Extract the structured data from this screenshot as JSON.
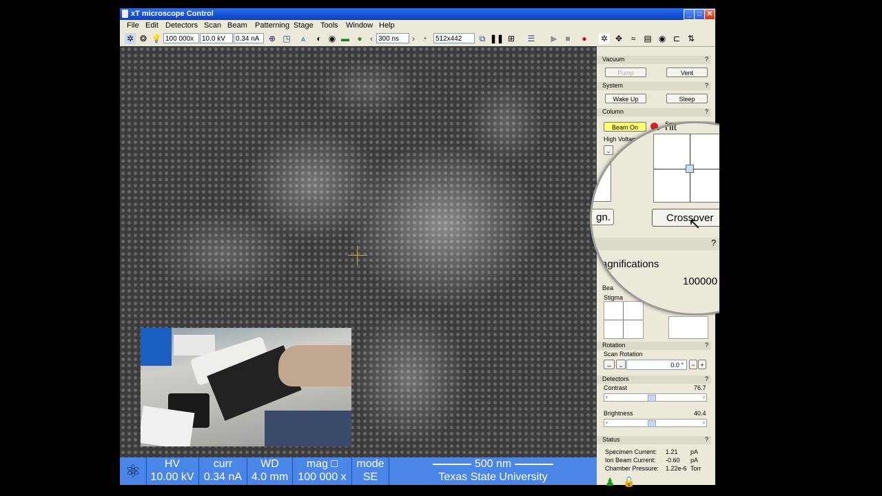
{
  "window": {
    "title": "xT microscope Control"
  },
  "menu": [
    "File",
    "Edit",
    "Detectors",
    "Scan",
    "Beam",
    "Patterning",
    "Stage",
    "Tools",
    "Window",
    "Help"
  ],
  "toolbar": {
    "magnification": "100 000x",
    "voltage": "10.0 kV",
    "current": "0.34 nA",
    "dwell": "300 ns",
    "resolution": "512x442"
  },
  "databar": {
    "hv_label": "HV",
    "hv_value": "10.00 kV",
    "curr_label": "curr",
    "curr_value": "0.34 nA",
    "wd_label": "WD",
    "wd_value": "4.0 mm",
    "mag_label": "mag",
    "mag_value": "100 000 x",
    "mode_label": "mode",
    "mode_value": "SE",
    "scalebar": "500 nm",
    "institution": "Texas State University"
  },
  "panel": {
    "vacuum": {
      "title": "Vacuum",
      "pump": "Pump",
      "vent": "Vent"
    },
    "system": {
      "title": "System",
      "wake": "Wake Up",
      "sleep": "Sleep"
    },
    "column": {
      "title": "Column",
      "beam_on": "Beam On",
      "source": "Source",
      "high_voltage": "High Voltage"
    },
    "stigmator": "Stigma",
    "beam_label": "Bea",
    "rotation": {
      "title": "Rotation",
      "scan_rotation": "Scan Rotation",
      "value": "0.0 °"
    },
    "detectors": {
      "title": "Detectors",
      "contrast": "Contrast",
      "contrast_value": "76.7",
      "contrast_level": 0.45,
      "brightness": "Brightness",
      "brightness_value": "40.4",
      "brightness_level": 0.45
    },
    "status": {
      "title": "Status",
      "rows": [
        {
          "label": "Specimen Current:",
          "value": "1.21",
          "unit": "pA"
        },
        {
          "label": "Ion Beam Current:",
          "value": "-0.60",
          "unit": "pA"
        },
        {
          "label": "Chamber Pressure:",
          "value": "1.22e-6",
          "unit": "Torr"
        }
      ]
    },
    "question": "?"
  },
  "magnifier": {
    "title": "Source Tilt",
    "crossover": "Crossover",
    "align": "gn.",
    "magnifications": "agnifications",
    "mag_value": "100000"
  }
}
